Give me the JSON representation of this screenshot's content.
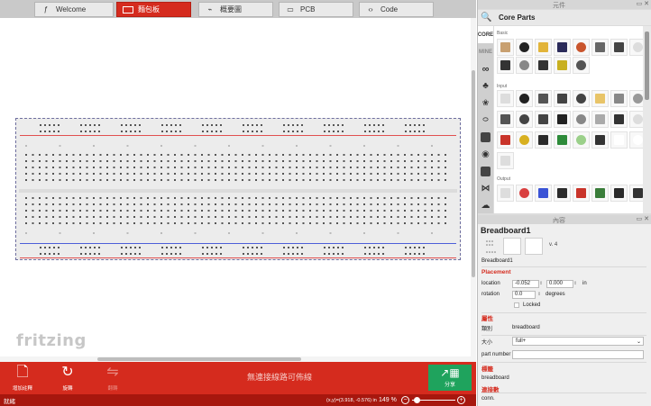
{
  "tabs": [
    {
      "label": "Welcome",
      "icon": "f-icon"
    },
    {
      "label": "麵包板",
      "icon": "breadboard-icon"
    },
    {
      "label": "概要圖",
      "icon": "schematic-icon"
    },
    {
      "label": "PCB",
      "icon": "pcb-icon"
    },
    {
      "label": "Code",
      "icon": "code-icon"
    }
  ],
  "active_tab": "麵包板",
  "canvas": {
    "logo": "fritzing"
  },
  "toolbar": {
    "add_note": "增加註釋",
    "rotate": "旋轉",
    "flip": "翻轉",
    "routing_status": "無連接線路可佈線",
    "share": "分享"
  },
  "statusbar": {
    "ready": "就緒",
    "coords": "(x,y)=(3.918, -0.576) in",
    "zoom": "149 %"
  },
  "parts_bin": {
    "header": "元件",
    "title": "Core Parts",
    "bin_tabs": [
      "CORE",
      "MINE"
    ],
    "sections": [
      "Basic",
      "Input",
      "Output"
    ]
  },
  "inspector": {
    "header": "內容",
    "title": "Breadboard1",
    "version": "v. 4",
    "instance_name": "Breadboard1",
    "placement_label": "Placement",
    "location_label": "location",
    "location_x": "-0.052",
    "location_y": "0.000",
    "location_unit": "in",
    "rotation_label": "rotation",
    "rotation_value": "0.0",
    "rotation_unit": "degrees",
    "locked_label": "Locked",
    "properties_label": "屬性",
    "family_label": "類別",
    "family_value": "breadboard",
    "size_label": "大小",
    "size_value": "full+",
    "part_number_label": "part number",
    "tags_label": "標籤",
    "tags_value": "breadboard",
    "connections_label": "連接數",
    "conn_label": "conn."
  },
  "colors": {
    "accent": "#d52b1e",
    "share_green": "#1fa35d",
    "status_red": "#a7170e"
  }
}
